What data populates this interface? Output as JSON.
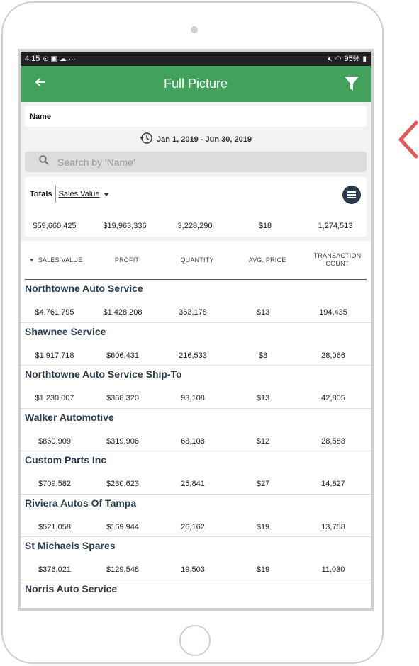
{
  "status_bar": {
    "time": "4:15",
    "battery": "95%"
  },
  "app_bar": {
    "title": "Full Picture"
  },
  "name_field": {
    "label": "Name"
  },
  "date_range": {
    "text": "Jan 1, 2019 - Jun 30, 2019"
  },
  "search": {
    "placeholder": "Search by 'Name'"
  },
  "totals": {
    "label": "Totals",
    "selector": "Sales Value",
    "values": [
      "$59,660,425",
      "$19,963,336",
      "3,228,290",
      "$18",
      "1,274,513"
    ]
  },
  "columns": {
    "sales_value": "SALES VALUE",
    "profit": "PROFIT",
    "quantity": "QUANTITY",
    "avg_price": "AVG. PRICE",
    "transaction_count_line1": "TRANSACTION",
    "transaction_count_line2": "COUNT"
  },
  "rows": [
    {
      "name": "Northtowne Auto Service",
      "sales": "$4,761,795",
      "profit": "$1,428,208",
      "quantity": "363,178",
      "avg_price": "$13",
      "count": "194,435"
    },
    {
      "name": "Shawnee Service",
      "sales": "$1,917,718",
      "profit": "$606,431",
      "quantity": "216,533",
      "avg_price": "$8",
      "count": "28,066"
    },
    {
      "name": "Northtowne Auto Service Ship-To",
      "sales": "$1,230,007",
      "profit": "$368,320",
      "quantity": "93,108",
      "avg_price": "$13",
      "count": "42,805"
    },
    {
      "name": "Walker Automotive",
      "sales": "$860,909",
      "profit": "$319,906",
      "quantity": "68,108",
      "avg_price": "$12",
      "count": "28,588"
    },
    {
      "name": "Custom Parts Inc",
      "sales": "$709,582",
      "profit": "$230,623",
      "quantity": "25,841",
      "avg_price": "$27",
      "count": "14,827"
    },
    {
      "name": "Riviera Autos Of Tampa",
      "sales": "$521,058",
      "profit": "$169,944",
      "quantity": "26,162",
      "avg_price": "$19",
      "count": "13,758"
    },
    {
      "name": "St Michaels Spares",
      "sales": "$376,021",
      "profit": "$129,548",
      "quantity": "19,503",
      "avg_price": "$19",
      "count": "11,030"
    },
    {
      "name": "Norris Auto Service",
      "sales": "",
      "profit": "",
      "quantity": "",
      "avg_price": "",
      "count": ""
    }
  ],
  "colors": {
    "app_bar": "#42a25c",
    "status_bar": "#212121",
    "accent_arrow": "#e05a5a",
    "text_dark": "#2b3a4a"
  }
}
